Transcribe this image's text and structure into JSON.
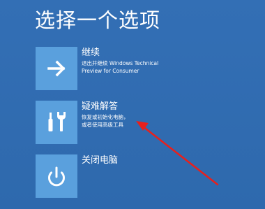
{
  "page": {
    "title": "选择一个选项"
  },
  "options": [
    {
      "title": "继续",
      "description_lines": [
        "退出并继续 Windows Technical",
        "Preview for Consumer"
      ],
      "icon": "right-arrow-icon"
    },
    {
      "title": "疑难解答",
      "description_lines": [
        "恢复或初始化电脑，",
        "或者使用高级工具"
      ],
      "icon": "tools-icon"
    },
    {
      "title": "关闭电脑",
      "description_lines": [],
      "icon": "power-icon"
    }
  ],
  "colors": {
    "background": "#2f6db3",
    "tile": "#5aa0dd",
    "annotation_arrow": "#e8201c"
  }
}
